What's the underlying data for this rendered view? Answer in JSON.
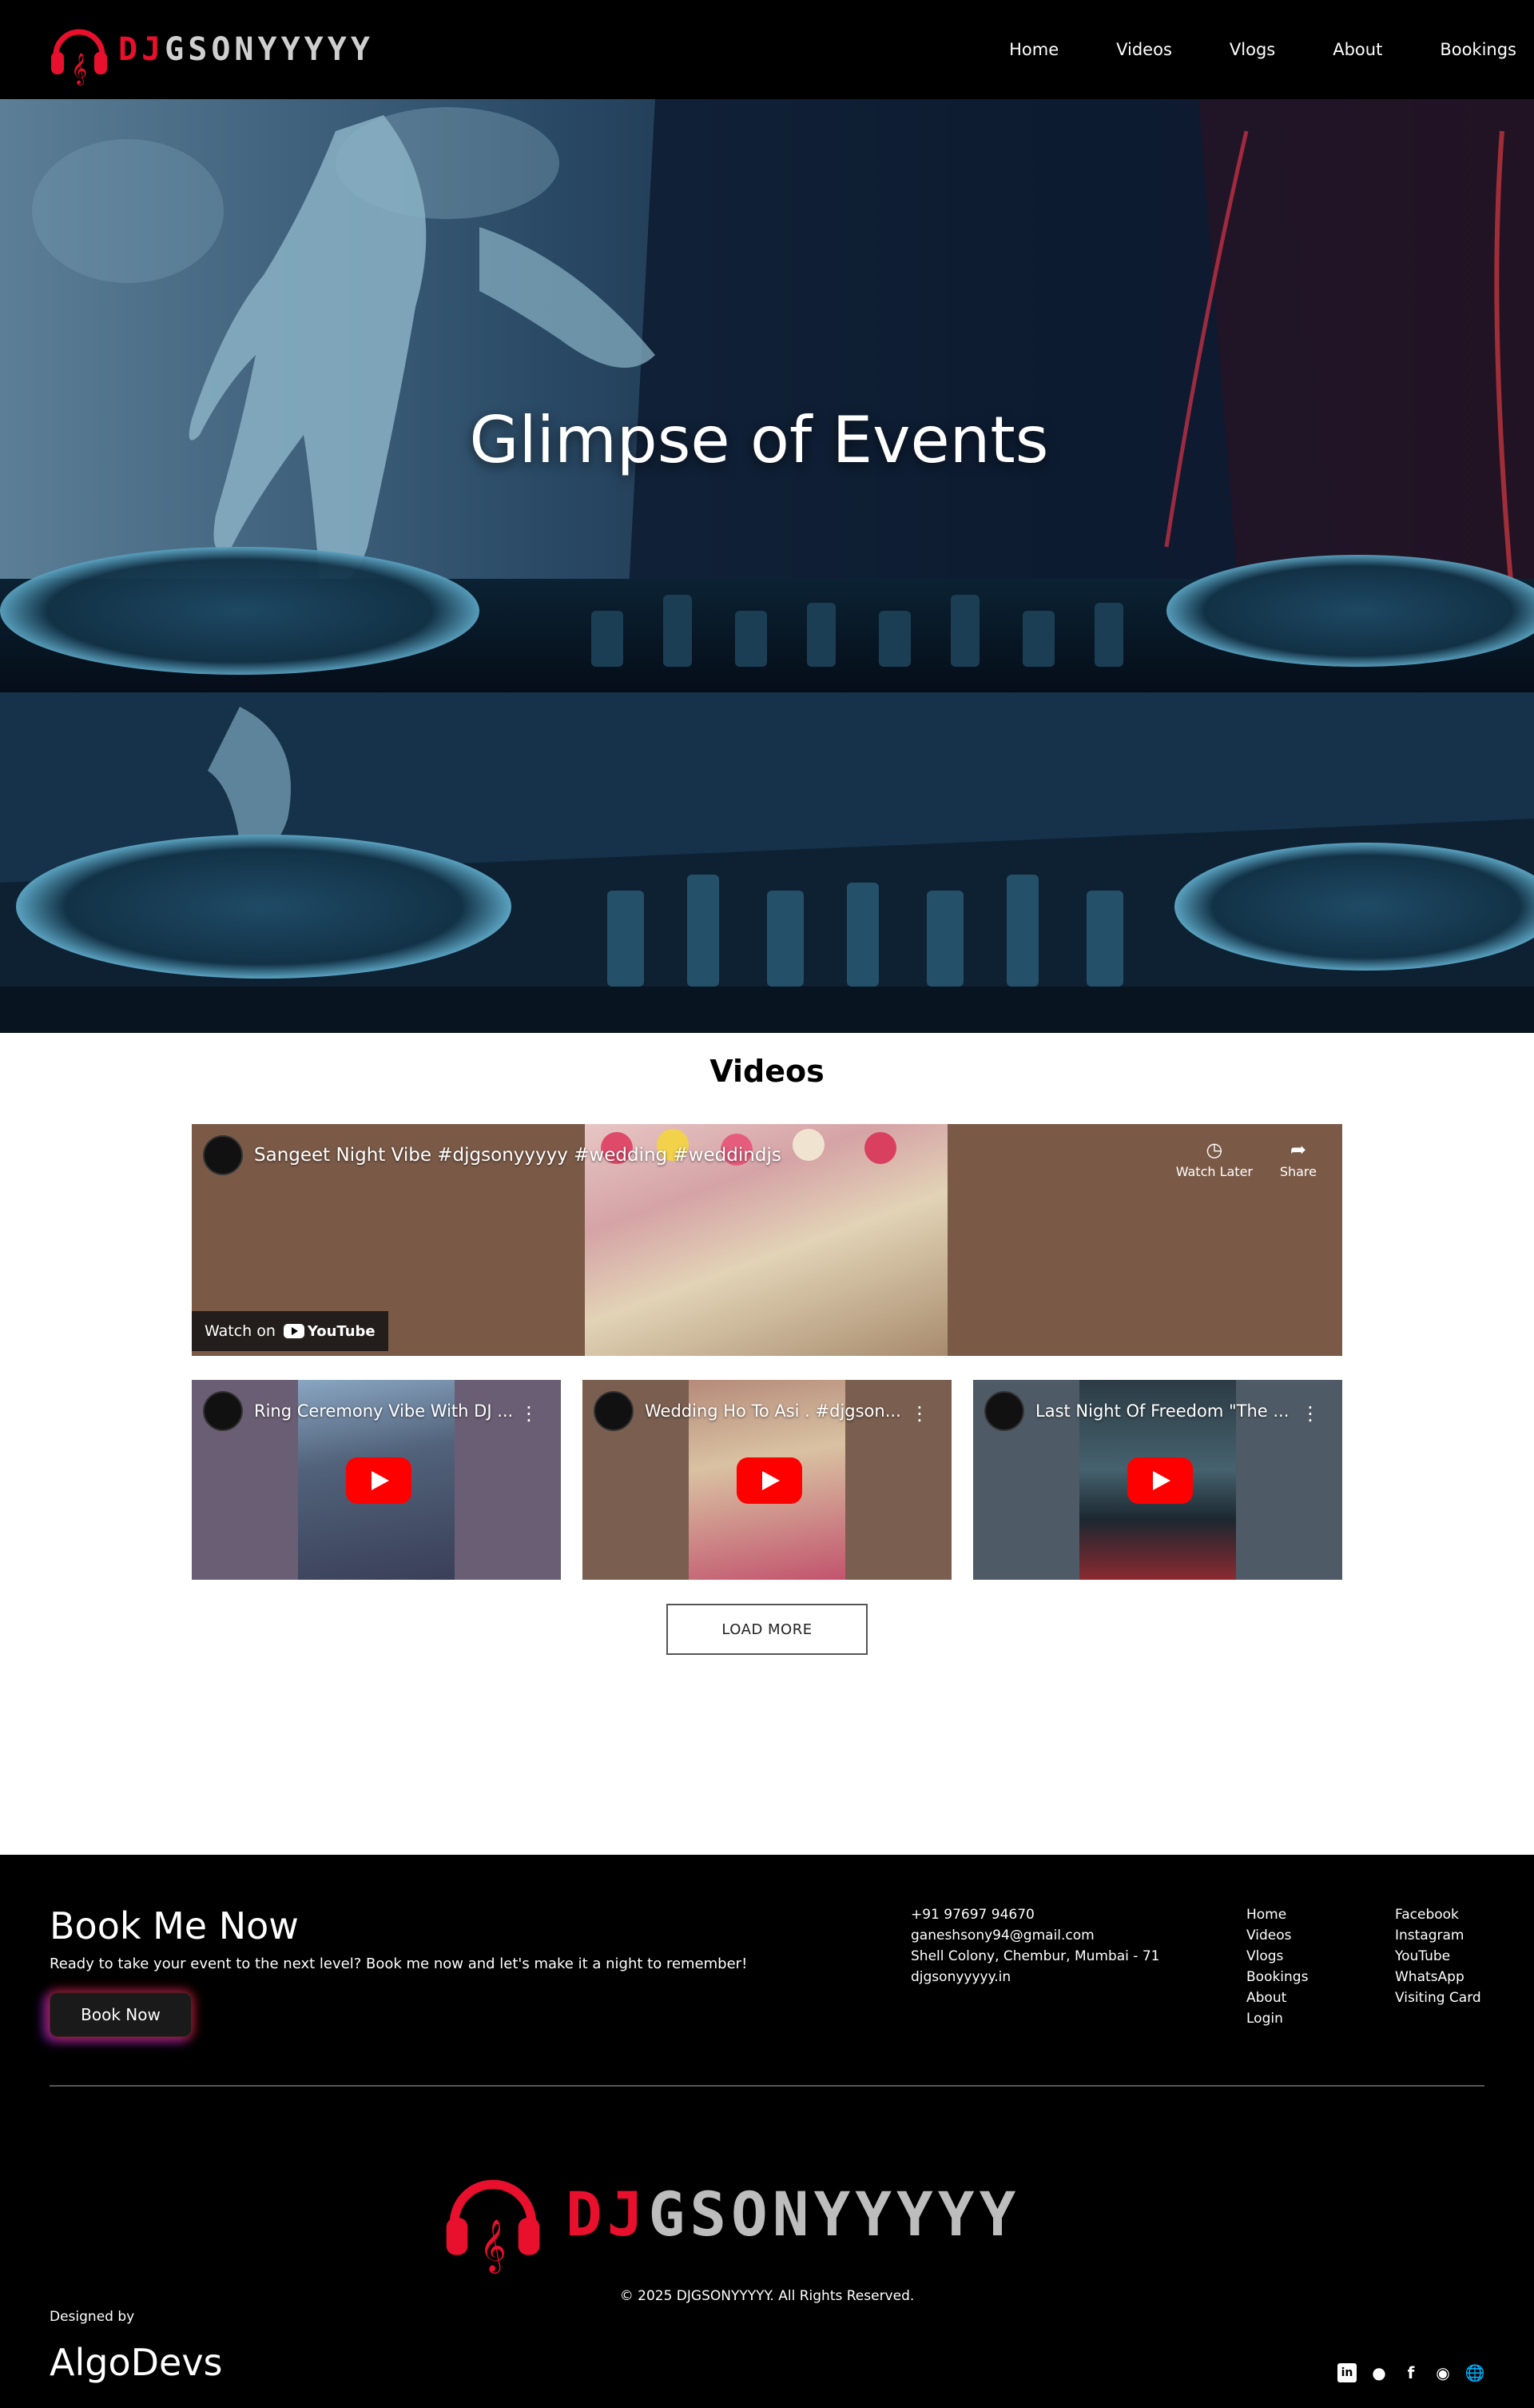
{
  "header": {
    "logo_dj": "DJ",
    "logo_rest": "GSONYYYYY",
    "nav": [
      "Home",
      "Videos",
      "Vlogs",
      "About",
      "Bookings"
    ]
  },
  "hero": {
    "title": "Glimpse of Events"
  },
  "videos": {
    "title": "Videos",
    "featured": {
      "title": "Sangeet Night Vibe #djgsonyyyyy #wedding #weddindjs",
      "watch_later": "Watch Later",
      "share": "Share",
      "watch_on": "Watch on",
      "youtube": "YouTube"
    },
    "cards": [
      {
        "title": "Ring Ceremony Vibe With DJ ..."
      },
      {
        "title": "Wedding Ho To Asi . #djgson..."
      },
      {
        "title": "Last Night Of Freedom \"The ..."
      }
    ],
    "load_more": "LOAD MORE"
  },
  "footer": {
    "title": "Book Me Now",
    "subtitle": "Ready to take your event to the next level? Book me now and let's make it a night to remember!",
    "book_button": "Book Now",
    "contact": [
      "+91 97697 94670",
      "ganeshsony94@gmail.com",
      "Shell Colony, Chembur, Mumbai - 71",
      "djgsonyyyyy.in"
    ],
    "links1": [
      "Home",
      "Videos",
      "Vlogs",
      "Bookings",
      "About",
      "Login"
    ],
    "links2": [
      "Facebook",
      "Instagram",
      "YouTube",
      "WhatsApp",
      "Visiting Card"
    ],
    "big_logo_dj": "DJ",
    "big_logo_rest": "GSONYYYYY",
    "copyright": "© 2025 DJGSONYYYYY. All Rights Reserved.",
    "designed_by": "Designed by",
    "designer": "AlgoDevs",
    "social_icons": [
      "linkedin-icon",
      "github-icon",
      "facebook-icon",
      "instagram-icon",
      "globe-icon"
    ]
  },
  "colors": {
    "brand_red": "#e8102c",
    "youtube_red": "#ff0000",
    "footer_bg": "#000000"
  }
}
